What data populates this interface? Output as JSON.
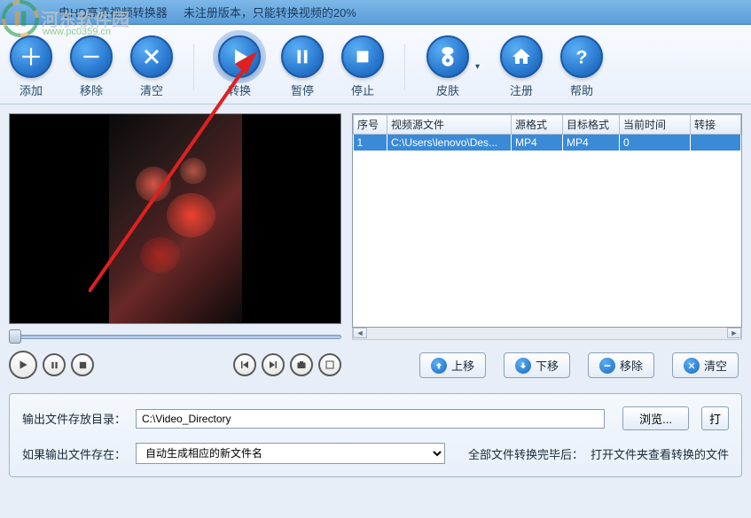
{
  "watermark": {
    "site_name": "河东软件园",
    "url": "www.pc0359.cn"
  },
  "titlebar": {
    "app_name_fragment": "电HD高清视频转换器",
    "trial_notice": "未注册版本，只能转换视频的20%"
  },
  "toolbar": {
    "add": "添加",
    "remove": "移除",
    "clear": "清空",
    "convert": "转换",
    "pause": "暂停",
    "stop": "停止",
    "skin": "皮肤",
    "register": "注册",
    "help": "帮助"
  },
  "table": {
    "headers": {
      "index": "序号",
      "source_file": "视频源文件",
      "source_format": "源格式",
      "target_format": "目标格式",
      "current_time": "当前时间",
      "convert_col": "转接"
    },
    "rows": [
      {
        "index": "1",
        "source_file": "C:\\Users\\lenovo\\Des...",
        "source_format": "MP4",
        "target_format": "MP4",
        "current_time": "0",
        "convert_col": ""
      }
    ]
  },
  "list_actions": {
    "move_up": "上移",
    "move_down": "下移",
    "remove": "移除",
    "clear": "清空"
  },
  "output": {
    "dir_label": "输出文件存放目录：",
    "dir_value": "C:\\Video_Directory",
    "browse": "浏览...",
    "open_btn": "打",
    "exists_label": "如果输出文件存在：",
    "exists_option": "自动生成相应的新文件名",
    "after_label": "全部文件转换完毕后：",
    "after_option": "打开文件夹查看转换的文件"
  }
}
